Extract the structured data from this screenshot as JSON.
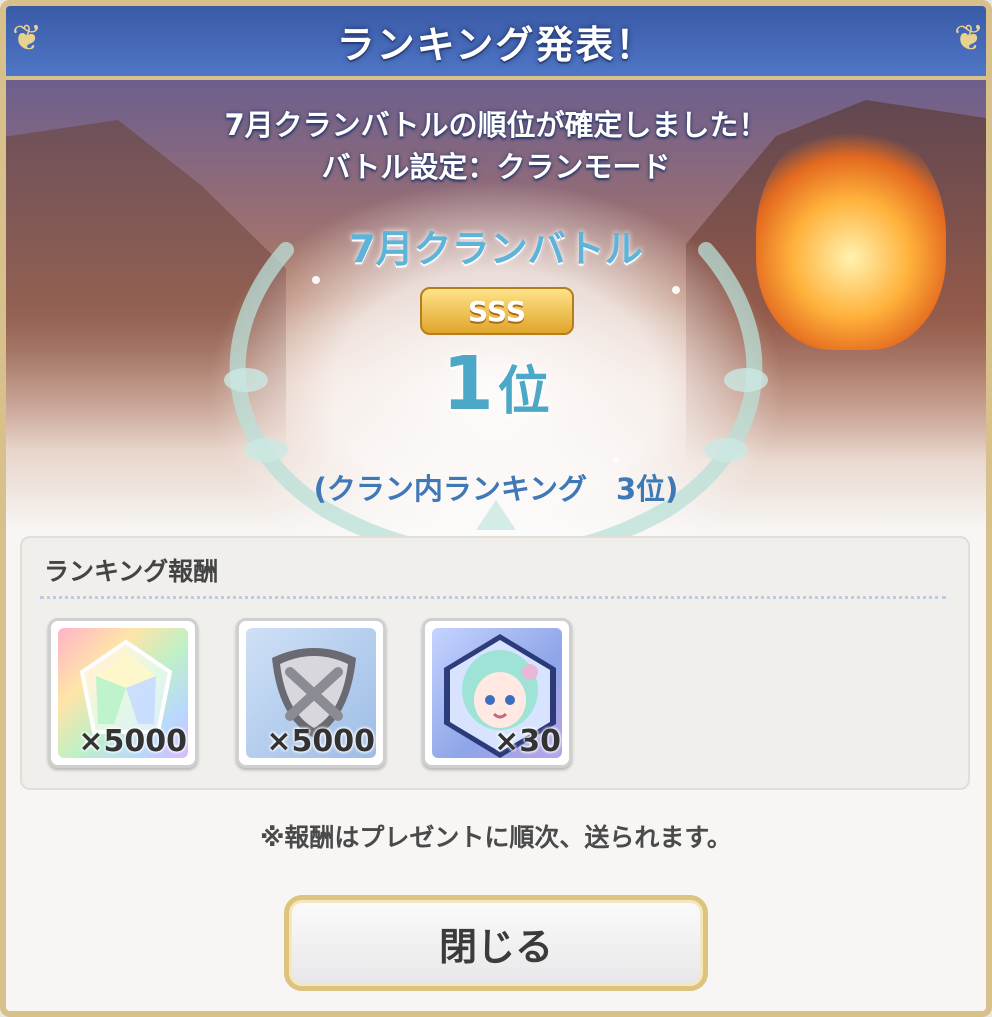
{
  "dialog": {
    "title": "ランキング発表！",
    "message_line1": "7月クランバトルの順位が確定しました！",
    "message_line2": "バトル設定：クランモード"
  },
  "result": {
    "battle_name": "7月クランバトル",
    "tier_badge": "SSS",
    "rank_number": "1",
    "rank_suffix": "位",
    "clan_internal_rank": "(クラン内ランキング　3位)"
  },
  "rewards": {
    "heading": "ランキング報酬",
    "items": [
      {
        "icon": "rainbow-jewel-icon",
        "count": "×5000"
      },
      {
        "icon": "mana-stone-icon",
        "count": "×5000"
      },
      {
        "icon": "character-memory-piece-icon",
        "count": "×30"
      }
    ]
  },
  "footer": {
    "note": "※報酬はプレゼントに順次、送られます。",
    "close_label": "閉じる"
  },
  "colors": {
    "titlebar": "#3f63b3",
    "gold_border": "#d7c08a",
    "rank_text": "#4da8c7",
    "clan_rank_text": "#3f78b6"
  }
}
